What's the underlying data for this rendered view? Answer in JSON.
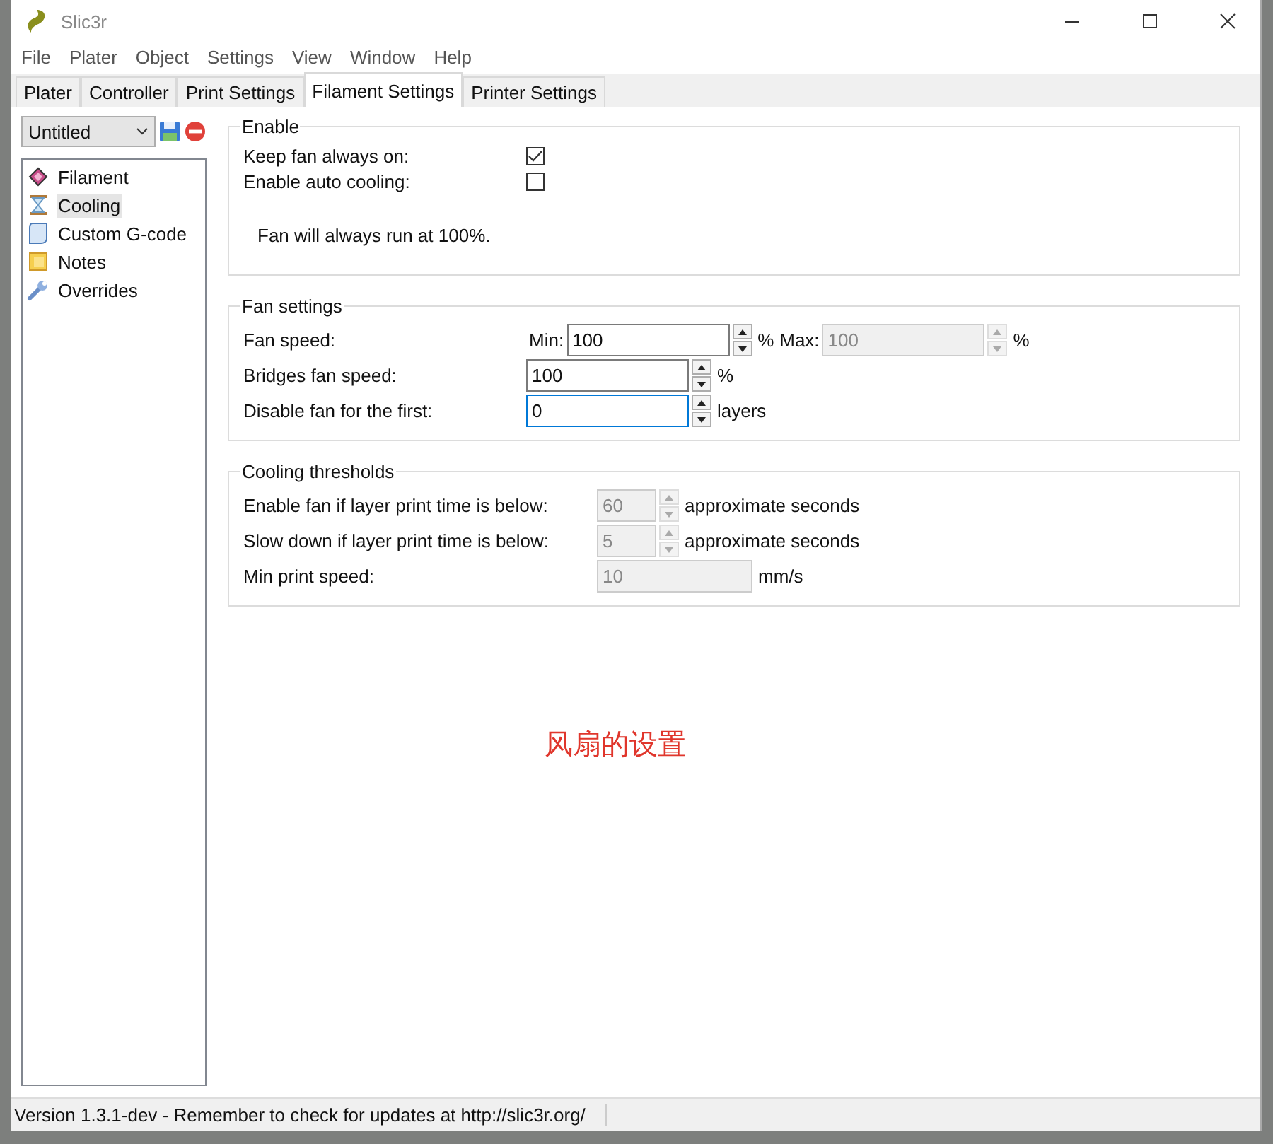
{
  "window": {
    "title": "Slic3r"
  },
  "menu": [
    "File",
    "Plater",
    "Object",
    "Settings",
    "View",
    "Window",
    "Help"
  ],
  "tabs": [
    {
      "label": "Plater",
      "selected": false
    },
    {
      "label": "Controller",
      "selected": false
    },
    {
      "label": "Print Settings",
      "selected": false
    },
    {
      "label": "Filament Settings",
      "selected": true
    },
    {
      "label": "Printer Settings",
      "selected": false
    }
  ],
  "preset": {
    "value": "Untitled"
  },
  "sidebar": {
    "items": [
      {
        "label": "Filament",
        "selected": false
      },
      {
        "label": "Cooling",
        "selected": true
      },
      {
        "label": "Custom G-code",
        "selected": false
      },
      {
        "label": "Notes",
        "selected": false
      },
      {
        "label": "Overrides",
        "selected": false
      }
    ]
  },
  "groups": [
    {
      "title": "Enable",
      "rows": [
        {
          "kind": "checkbox",
          "label": "Keep fan always on:",
          "checked": true
        },
        {
          "kind": "checkbox",
          "label": "Enable auto cooling:",
          "checked": false
        },
        {
          "kind": "note",
          "text": "Fan will always run at 100%."
        }
      ]
    },
    {
      "title": "Fan settings",
      "rows": [
        {
          "kind": "minmax",
          "label": "Fan speed:",
          "min": {
            "prefix": "Min:",
            "value": "100",
            "unit": "%",
            "disabled": false
          },
          "max": {
            "prefix": "Max:",
            "value": "100",
            "unit": "%",
            "disabled": true
          }
        },
        {
          "kind": "spin",
          "label": "Bridges fan speed:",
          "value": "100",
          "unit": "%",
          "disabled": false,
          "focused": false
        },
        {
          "kind": "spin",
          "label": "Disable fan for the first:",
          "value": "0",
          "unit": "layers",
          "disabled": false,
          "focused": true
        }
      ]
    },
    {
      "title": "Cooling thresholds",
      "rows": [
        {
          "kind": "spin",
          "label": "Enable fan if layer print time is below:",
          "value": "60",
          "unit": "approximate seconds",
          "disabled": true,
          "focused": false
        },
        {
          "kind": "spin",
          "label": "Slow down if layer print time is below:",
          "value": "5",
          "unit": "approximate seconds",
          "disabled": true,
          "focused": false
        },
        {
          "kind": "text",
          "label": "Min print speed:",
          "value": "10",
          "unit": "mm/s",
          "disabled": true
        }
      ]
    }
  ],
  "annotation": "风扇的设置",
  "status_bar": "Version 1.3.1-dev - Remember to check for updates at http://slic3r.org/"
}
